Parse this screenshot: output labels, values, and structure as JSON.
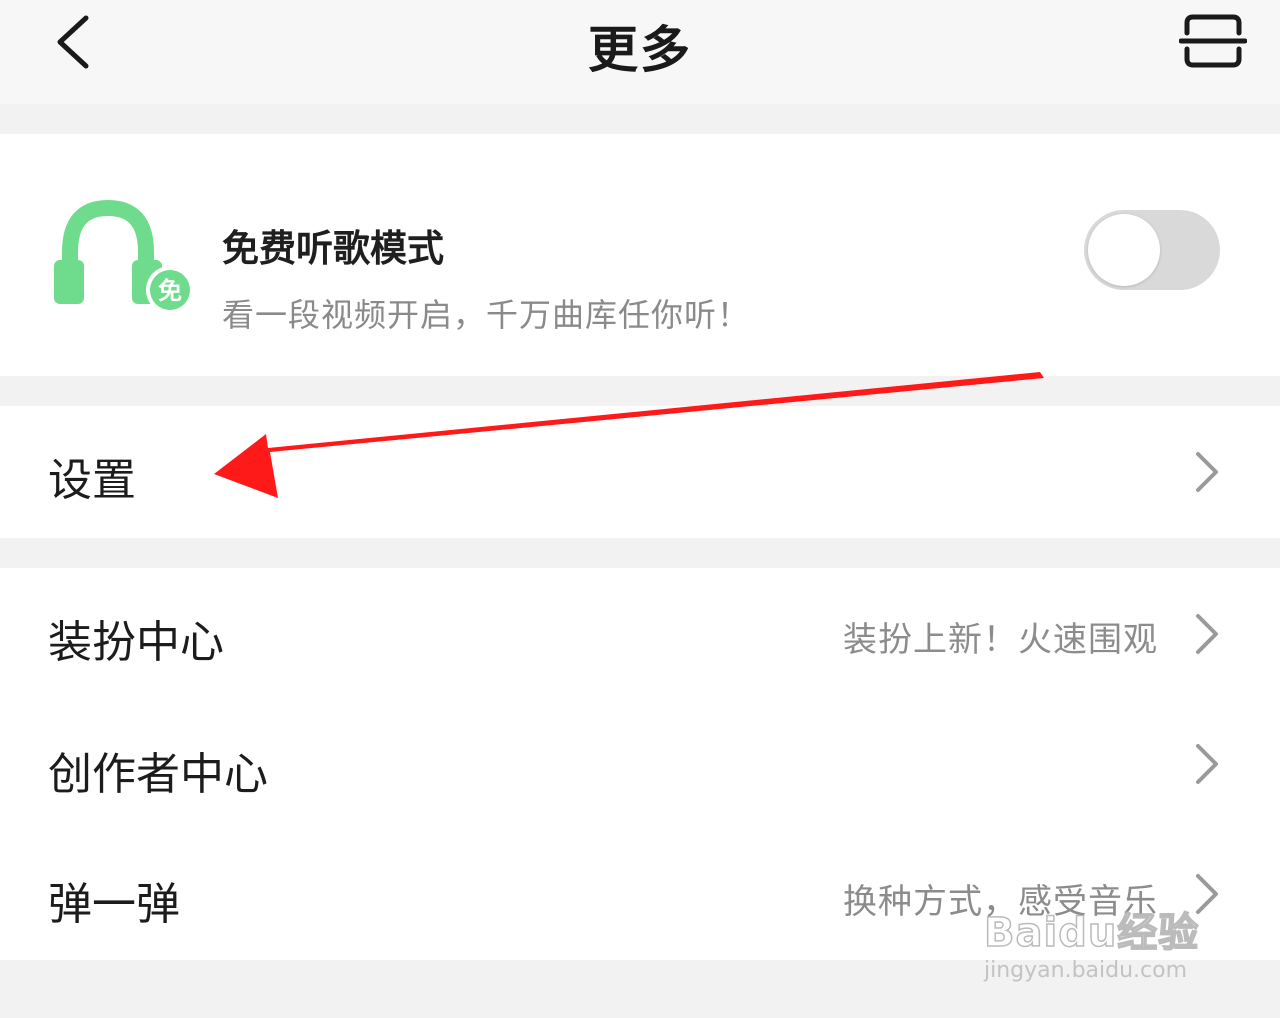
{
  "header": {
    "title": "更多",
    "back_icon": "chevron-left-icon",
    "scan_icon": "scan-icon"
  },
  "free_mode": {
    "icon": "headphone-icon",
    "badge": "免",
    "title": "免费听歌模式",
    "subtitle": "看一段视频开启，千万曲库任你听！",
    "toggle_on": false,
    "accent": "#6edc8c"
  },
  "settings": {
    "label": "设置"
  },
  "menu": {
    "items": [
      {
        "label": "装扮中心",
        "hint": "装扮上新！火速围观"
      },
      {
        "label": "创作者中心",
        "hint": ""
      },
      {
        "label": "弹一弹",
        "hint": "换种方式，感受音乐"
      }
    ]
  },
  "annotation": {
    "arrow_color": "#ff1a1a"
  },
  "watermark": {
    "logo": "Baidu经验",
    "url": "jingyan.baidu.com"
  }
}
